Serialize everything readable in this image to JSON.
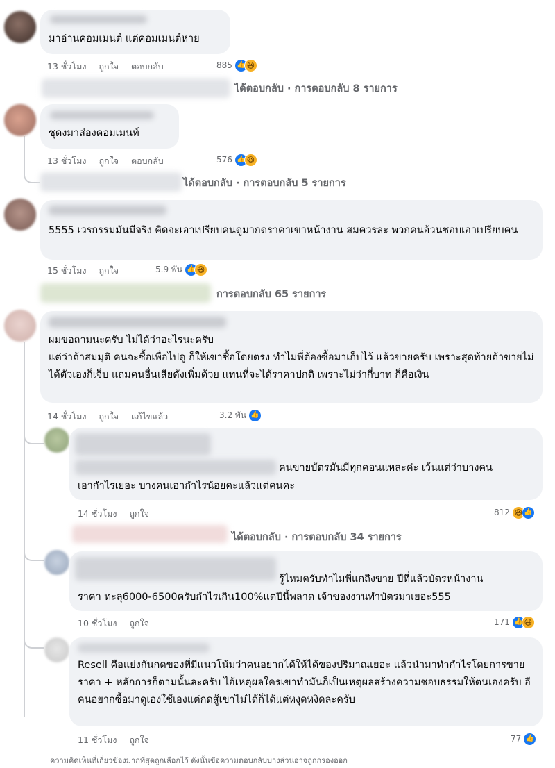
{
  "comments": [
    {
      "text": "มาอ่านคอมเมนต์ แต่คอมเมนต์หาย",
      "time": "13 ชั่วโมง",
      "like": "ถูกใจ",
      "reply": "ตอบกลับ",
      "count": "885",
      "replies": "ได้ตอบกลับ · การตอบกลับ 8 รายการ"
    },
    {
      "text": "ชุดงมาส่องคอมเมนท์",
      "time": "13 ชั่วโมง",
      "like": "ถูกใจ",
      "reply": "ตอบกลับ",
      "count": "576",
      "replies": "ได้ตอบกลับ · การตอบกลับ 5 รายการ"
    },
    {
      "text": "5555 เวรกรรมมันมีจริง คิดจะเอาเปรียบคนดูมากดราคาเขาหน้างาน สมควรละ พวกคนอ้วนชอบเอาเปรียบคน",
      "time": "15 ชั่วโมง",
      "like": "ถูกใจ",
      "count": "5.9 พัน",
      "replies": "การตอบกลับ 65 รายการ"
    },
    {
      "text": "ผมขอถามนะครับ ไม่ได้ว่าอะไรนะครับ\nแต่ว่าถ้าสมมุติ คนจะซื้อเพื่อไปดู ก็ให้เขาซื้อโดยตรง ทำไมพี่ต้องซื้อมาเก็บไว้ แล้วขายครับ เพราะสุดท้ายถ้าขายไม่ได้ตัวเองก็เจ็บ แถมคนอื่นเสียดังเพิ่มด้วย แทนที่จะได้ราคาปกติ เพราะไม่ว่ากี่บาท ก็คือเงิน",
      "time": "14 ชั่วโมง",
      "like": "ถูกใจ",
      "edited": "แก้ไขแล้ว",
      "count": "3.2 พัน"
    }
  ],
  "replies_list": [
    {
      "text1": "คนขายบัตรมันมีทุกคอนแหละค่ะ เว้นแต่ว่าบางคน",
      "text2": "เอากำไรเยอะ บางคนเอากำไรน้อยคะแล้วแต่คนคะ",
      "time": "14 ชั่วโมง",
      "like": "ถูกใจ",
      "count": "812",
      "replies": "ได้ตอบกลับ · การตอบกลับ 34 รายการ"
    },
    {
      "text1": "รู้ไหมครับทำไมพี่แกถึงขาย ปีที่แล้วบัตรหน้างาน",
      "text2": "ราคา ทะลุ6000-6500ครับกำไรเกิน100%แต่ปีนี้พลาด เจ้าของงานทำบัตรมาเยอะ555",
      "time": "10 ชั่วโมง",
      "like": "ถูกใจ",
      "count": "171"
    },
    {
      "text": "Resell คือแย่งกันกดของที่มีแนวโน้มว่าคนอยากได้ให้ได้ของปริมาณเยอะ แล้วนำมาทำกำไรโดยการขายราคา + หลักการก็ตามนั้นละครับ ไอ้เหตุผลใครเขาทำมันก็เป็นเหตุผลสร้างความชอบธรรมให้ตนเองครับ อีคนอยากซื้อมาดูเองใช้เองแต่กดสู้เขาไม่ได้ก็ได้แต่หงุดหงิดละครับ",
      "time": "11 ชั่วโมง",
      "like": "ถูกใจ",
      "count": "77"
    }
  ],
  "footer": "ความคิดเห็นที่เกี่ยวข้องมากที่สุดถูกเลือกไว้ ดังนั้นข้อความตอบกลับบางส่วนอาจถูกกรองออก",
  "icons": {
    "like": "like-icon",
    "haha": "haha-icon"
  },
  "colors": {
    "bubble": "#f0f2f5",
    "meta": "#65676b",
    "like": "#1877f2",
    "haha": "#f7b125"
  }
}
